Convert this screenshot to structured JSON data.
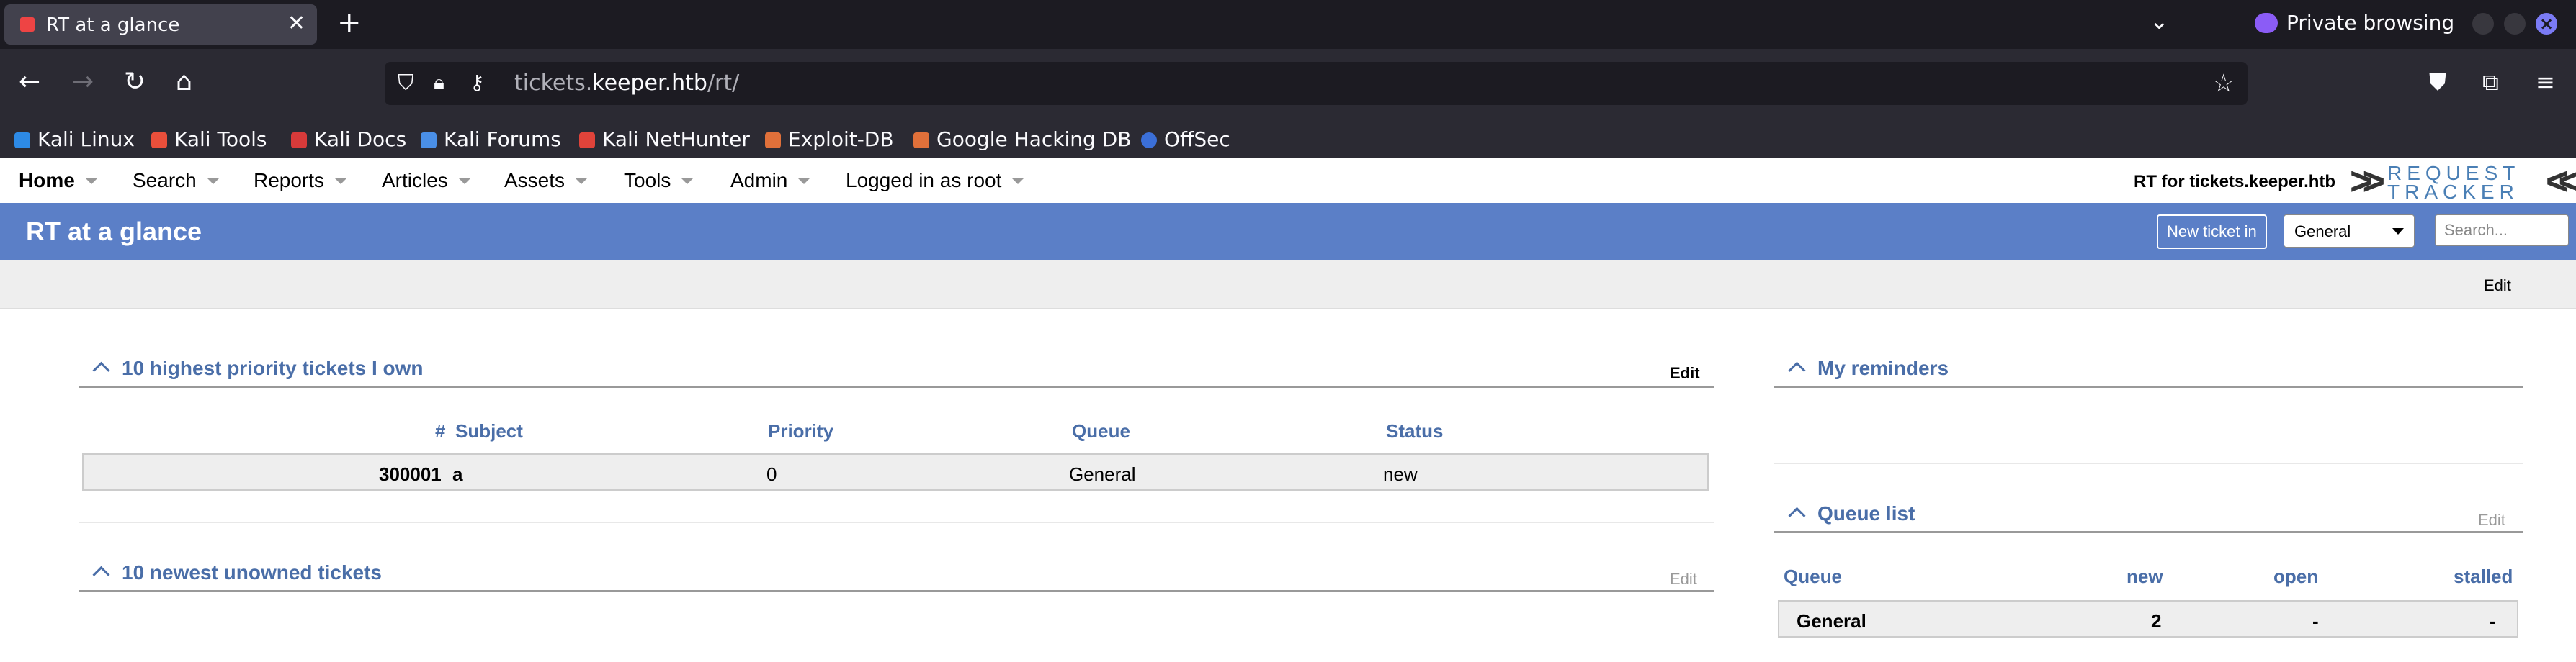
{
  "browser": {
    "tab_title": "RT at a glance",
    "close_glyph": "✕",
    "new_tab_glyph": "+",
    "private_label": "Private browsing",
    "url_prefix": "tickets.",
    "url_host": "keeper.htb",
    "url_path": "/rt/",
    "bookmarks": [
      {
        "label": "Kali Linux",
        "color": "#2d8ae6"
      },
      {
        "label": "Kali Tools",
        "color": "#e94f3b"
      },
      {
        "label": "Kali Docs",
        "color": "#d73a3a"
      },
      {
        "label": "Kali Forums",
        "color": "#4a8fe7"
      },
      {
        "label": "Kali NetHunter",
        "color": "#e0433a"
      },
      {
        "label": "Exploit-DB",
        "color": "#e0703a"
      },
      {
        "label": "Google Hacking DB",
        "color": "#e0703a"
      },
      {
        "label": "OffSec",
        "color": "#3b6fd8"
      }
    ]
  },
  "rt": {
    "menu": {
      "home": "Home",
      "search": "Search",
      "reports": "Reports",
      "articles": "Articles",
      "assets": "Assets",
      "tools": "Tools",
      "admin": "Admin",
      "logged_in": "Logged in as root"
    },
    "site_label": "RT for tickets.keeper.htb",
    "logo_word1": "REQUEST",
    "logo_word2": "TRACKER",
    "page_title": "RT at a glance",
    "new_ticket_label": "New ticket in",
    "queue_selected": "General",
    "search_placeholder": "Search...",
    "page_edit": "Edit",
    "owned_portlet": {
      "title": "10 highest priority tickets I own",
      "edit": "Edit",
      "columns": {
        "id": "#",
        "subject": "Subject",
        "priority": "Priority",
        "queue": "Queue",
        "status": "Status"
      },
      "rows": [
        {
          "id": "300001",
          "subject": "a",
          "priority": "0",
          "queue": "General",
          "status": "new"
        }
      ]
    },
    "unowned_portlet": {
      "title": "10 newest unowned tickets",
      "edit": "Edit"
    },
    "reminders_portlet": {
      "title": "My reminders"
    },
    "queue_portlet": {
      "title": "Queue list",
      "edit": "Edit",
      "columns": {
        "queue": "Queue",
        "new": "new",
        "open": "open",
        "stalled": "stalled"
      },
      "rows": [
        {
          "queue": "General",
          "new": "2",
          "open": "-",
          "stalled": "-"
        }
      ]
    }
  },
  "colors": {
    "header_blue": "#5b7fc7",
    "link_blue": "#4a6ea8",
    "chrome_dark": "#1c1b22",
    "private_purple": "#8b5cf6"
  }
}
